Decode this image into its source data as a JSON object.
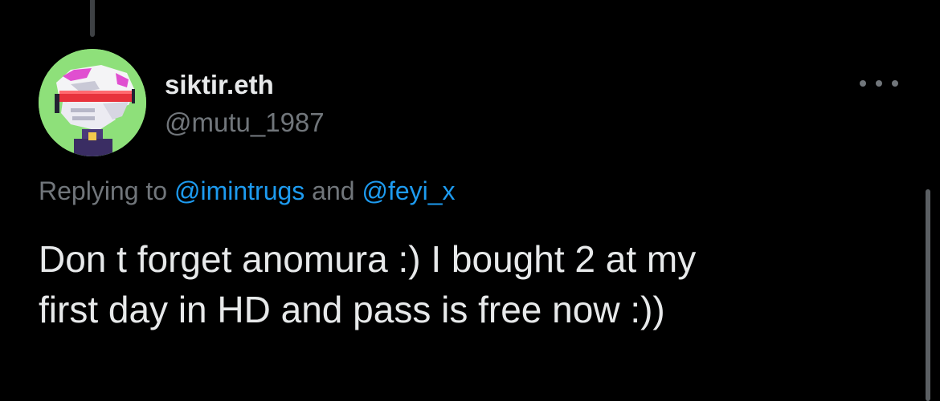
{
  "tweet": {
    "author": {
      "display_name": "siktir.eth",
      "handle": "@mutu_1987",
      "avatar_icon": "pixel-helmet-avatar-icon"
    },
    "replying_to": {
      "prefix": "Replying to",
      "mention_1": "@imintrugs",
      "conjunction": "and",
      "mention_2": "@feyi_x"
    },
    "text_lines": [
      "Don t forget anomura :) I bought 2 at my",
      "first day in HD and pass is free now :))"
    ],
    "more_icon": "more-horizontal-icon"
  },
  "colors": {
    "background": "#000000",
    "primary_text": "#e7e9ea",
    "secondary_text": "#71767b",
    "link": "#1d9bf0",
    "avatar_bg": "#8ee07a"
  }
}
